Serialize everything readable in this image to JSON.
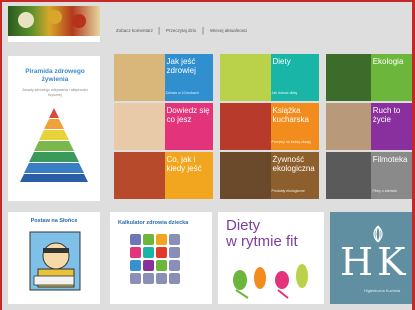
{
  "nav": {
    "links": [
      "Zobacz komentarz",
      "Przeczytaj dzis",
      "Wiecej aktualnosci"
    ]
  },
  "pyramid": {
    "title": "Piramida zdrowego żywienia",
    "description": "Zasady zdrowego odżywiania i aktywności fizycznej"
  },
  "tiles": [
    {
      "label": "Jak jeść zdrowiej",
      "sub": "Zdrowo w 10 krokach",
      "color": "#2f8fcf",
      "photo": "#d9b67a"
    },
    {
      "label": "Diety",
      "sub": "Jak dobrać dietę",
      "color": "#19b5a6",
      "photo": "#b9d24a"
    },
    {
      "label": "Ekologia",
      "sub": "",
      "color": "#6cb73b",
      "photo": "#3d6b2a"
    },
    {
      "label": "Dowiedz się co jesz",
      "sub": "",
      "color": "#e3347b",
      "photo": "#e8c9a8"
    },
    {
      "label": "Książka kucharska",
      "sub": "Przepisy na każdą okazję",
      "color": "#f28c1c",
      "photo": "#b83a2a"
    },
    {
      "label": "Ruch to życie",
      "sub": "",
      "color": "#8a2f9e",
      "photo": "#b89a7a"
    },
    {
      "label": "Co, jak i kiedy jeść",
      "sub": "",
      "color": "#f2a51f",
      "photo": "#b74a2b"
    },
    {
      "label": "Żywność ekologiczna",
      "sub": "Produkty ekologiczne",
      "color": "#8c5f2c",
      "photo": "#6a4a2a"
    },
    {
      "label": "Filmoteka",
      "sub": "Filmy o zdrowiu",
      "color": "#8a8a8a",
      "photo": "#5a5a5a"
    }
  ],
  "sun": {
    "title": "Postaw na Słońce"
  },
  "calculator": {
    "title": "Kalkulator zdrowia dziecka"
  },
  "diet_card": {
    "title_line1": "Diety",
    "title_line2": "w rytmie fit"
  },
  "hk": {
    "letters": "HK",
    "caption": "Higieniczna Kuchnia"
  }
}
